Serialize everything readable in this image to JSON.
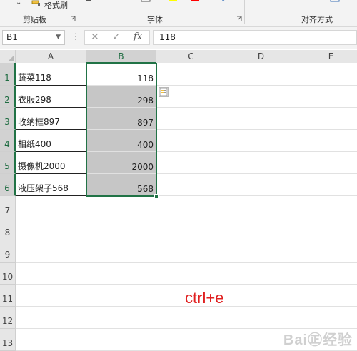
{
  "ribbon": {
    "clipboard_group": "剪贴板",
    "format_painter": "格式刷",
    "font_group": "字体",
    "alignment_group": "对齐方式",
    "colors": {
      "highlight": "#ffff00",
      "font_color": "#ff0000"
    }
  },
  "formula_bar": {
    "name_box": "B1",
    "cancel_icon": "close-icon",
    "enter_icon": "check-icon",
    "fx_label": "fx",
    "formula": "118"
  },
  "sheet": {
    "columns": [
      "A",
      "B",
      "C",
      "D",
      "E"
    ],
    "selected_column": "B",
    "rows": [
      "1",
      "2",
      "3",
      "4",
      "5",
      "6",
      "7",
      "8",
      "9",
      "10",
      "11",
      "12",
      "13"
    ],
    "selected_rows": [
      "1",
      "2",
      "3",
      "4",
      "5",
      "6"
    ],
    "cells_a": [
      "蔬菜118",
      "衣服298",
      "收纳框897",
      "相纸400",
      "摄像机2000",
      "液压架子568"
    ],
    "cells_b": [
      "118",
      "298",
      "897",
      "400",
      "2000",
      "568"
    ]
  },
  "annotation": "ctrl+e",
  "colors": {
    "accent": "#217346",
    "annotation": "#e02020",
    "selection_fill": "#c6c6c6"
  }
}
